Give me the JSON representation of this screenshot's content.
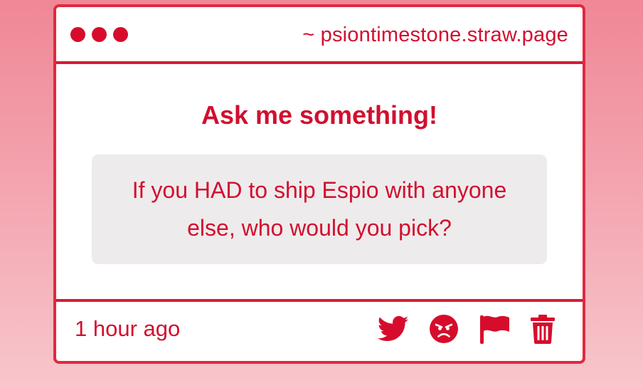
{
  "window": {
    "url": "~ psiontimestone.straw.page"
  },
  "main": {
    "heading": "Ask me something!",
    "question": "If you HAD to ship Espio with anyone else, who would you pick?"
  },
  "footer": {
    "timestamp": "1 hour ago",
    "actions": [
      {
        "icon": "twitter-icon"
      },
      {
        "icon": "angry-face-icon"
      },
      {
        "icon": "flag-icon"
      },
      {
        "icon": "trash-icon"
      }
    ]
  },
  "colors": {
    "accent": "#d20f2f",
    "border": "#e0293f",
    "question_background": "#eeebec",
    "page_background_top": "#f08796",
    "page_background_bottom": "#f8c6cc"
  }
}
